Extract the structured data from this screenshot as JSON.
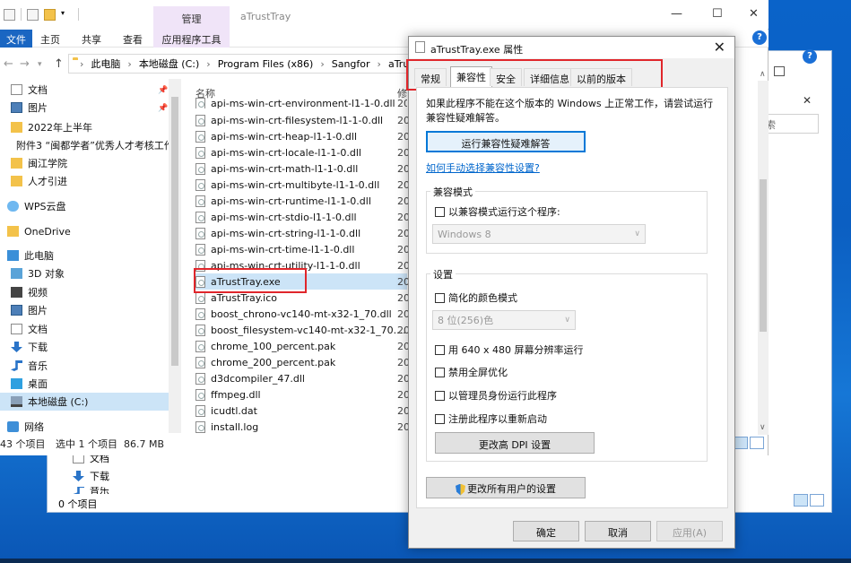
{
  "background_window": {
    "status": "0 个项目",
    "nav_items": [
      "文档",
      "下载",
      "音乐"
    ]
  },
  "explorer": {
    "title": "aTrustTray",
    "manage_tab": "管理",
    "ribbon_tabs": [
      "文件",
      "主页",
      "共享",
      "查看",
      "应用程序工具"
    ],
    "address": [
      "此电脑",
      "本地磁盘 (C:)",
      "Program Files (x86)",
      "Sangfor",
      "aTrust"
    ],
    "nav_items": [
      {
        "label": "文档",
        "icon": "document-icon",
        "pinned": true
      },
      {
        "label": "图片",
        "icon": "picture-icon",
        "pinned": true
      },
      {
        "label": "2022年上半年",
        "icon": "folder-icon"
      },
      {
        "label": "附件3 “闽都学者”优秀人才考核工作",
        "icon": "folder-icon"
      },
      {
        "label": "闽江学院",
        "icon": "folder-icon"
      },
      {
        "label": "人才引进",
        "icon": "folder-icon"
      },
      {
        "label": "WPS云盘",
        "icon": "cloud-icon"
      },
      {
        "label": "OneDrive",
        "icon": "folder-icon"
      },
      {
        "label": "此电脑",
        "icon": "computer-icon"
      },
      {
        "label": "3D 对象",
        "icon": "3d-objects-icon"
      },
      {
        "label": "视频",
        "icon": "video-icon"
      },
      {
        "label": "图片",
        "icon": "picture-icon"
      },
      {
        "label": "文档",
        "icon": "document-icon"
      },
      {
        "label": "下载",
        "icon": "download-icon"
      },
      {
        "label": "音乐",
        "icon": "music-icon"
      },
      {
        "label": "桌面",
        "icon": "desktop-icon"
      },
      {
        "label": "本地磁盘 (C:)",
        "icon": "drive-icon",
        "selected": true
      },
      {
        "label": "网络",
        "icon": "network-icon"
      }
    ],
    "columns": {
      "name": "名称",
      "date": "修"
    },
    "files": [
      {
        "name": "api-ms-win-crt-environment-l1-1-0.dll",
        "date": "20"
      },
      {
        "name": "api-ms-win-crt-filesystem-l1-1-0.dll",
        "date": "20"
      },
      {
        "name": "api-ms-win-crt-heap-l1-1-0.dll",
        "date": "20"
      },
      {
        "name": "api-ms-win-crt-locale-l1-1-0.dll",
        "date": "20"
      },
      {
        "name": "api-ms-win-crt-math-l1-1-0.dll",
        "date": "20"
      },
      {
        "name": "api-ms-win-crt-multibyte-l1-1-0.dll",
        "date": "20"
      },
      {
        "name": "api-ms-win-crt-runtime-l1-1-0.dll",
        "date": "20"
      },
      {
        "name": "api-ms-win-crt-stdio-l1-1-0.dll",
        "date": "20"
      },
      {
        "name": "api-ms-win-crt-string-l1-1-0.dll",
        "date": "20"
      },
      {
        "name": "api-ms-win-crt-time-l1-1-0.dll",
        "date": "20"
      },
      {
        "name": "api-ms-win-crt-utility-l1-1-0.dll",
        "date": "20"
      },
      {
        "name": "aTrustTray.exe",
        "date": "20",
        "selected": true
      },
      {
        "name": "aTrustTray.ico",
        "date": "20"
      },
      {
        "name": "boost_chrono-vc140-mt-x32-1_70.dll",
        "date": "20"
      },
      {
        "name": "boost_filesystem-vc140-mt-x32-1_70....",
        "date": "20"
      },
      {
        "name": "chrome_100_percent.pak",
        "date": "20"
      },
      {
        "name": "chrome_200_percent.pak",
        "date": "20"
      },
      {
        "name": "d3dcompiler_47.dll",
        "date": "20"
      },
      {
        "name": "ffmpeg.dll",
        "date": "20"
      },
      {
        "name": "icudtl.dat",
        "date": "20"
      },
      {
        "name": "install.log",
        "date": "20"
      }
    ],
    "status_count": "43 个项目",
    "status_selected": "选中 1 个项目  86.7 MB"
  },
  "dialog": {
    "title": "aTrustTray.exe 属性",
    "tabs": [
      "常规",
      "兼容性",
      "安全",
      "详细信息",
      "以前的版本"
    ],
    "active_tab": "兼容性",
    "intro": "如果此程序不能在这个版本的 Windows 上正常工作，请尝试运行兼容性疑难解答。",
    "run_troubleshooter": "运行兼容性疑难解答",
    "manual_link": "如何手动选择兼容性设置?",
    "compat_group": "兼容模式",
    "compat_checkbox": "以兼容模式运行这个程序:",
    "compat_os": "Windows 8",
    "settings_group": "设置",
    "reduced_color": "简化的颜色模式",
    "color_depth": "8 位(256)色",
    "res_640": "用 640 x 480 屏幕分辨率运行",
    "disable_fullscreen": "禁用全屏优化",
    "run_admin": "以管理员身份运行此程序",
    "register_restart": "注册此程序以重新启动",
    "change_dpi": "更改高 DPI 设置",
    "change_all_users": "更改所有用户的设置",
    "ok": "确定",
    "cancel": "取消",
    "apply": "应用(A)"
  }
}
